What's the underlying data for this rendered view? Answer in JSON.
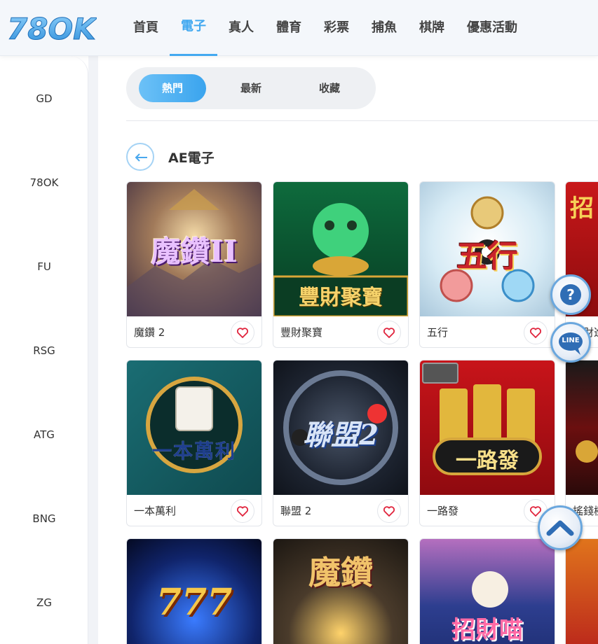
{
  "brand": {
    "logo_text": "78OK",
    "accent": "#43a9f0"
  },
  "nav": {
    "items": [
      {
        "label": "首頁"
      },
      {
        "label": "電子"
      },
      {
        "label": "真人"
      },
      {
        "label": "體育"
      },
      {
        "label": "彩票"
      },
      {
        "label": "捕魚"
      },
      {
        "label": "棋牌"
      },
      {
        "label": "優惠活動"
      }
    ],
    "active": "電子"
  },
  "sidebar": {
    "items": [
      {
        "label": "GD"
      },
      {
        "label": "78OK"
      },
      {
        "label": "FU"
      },
      {
        "label": "RSG"
      },
      {
        "label": "ATG"
      },
      {
        "label": "BNG"
      },
      {
        "label": "ZG"
      }
    ]
  },
  "filter_tabs": [
    {
      "label": "熱門",
      "active": true
    },
    {
      "label": "最新",
      "active": false
    },
    {
      "label": "收藏",
      "active": false
    }
  ],
  "section": {
    "title": "AE電子",
    "back_icon": "arrow-left-icon"
  },
  "games": [
    {
      "name": "魔鑽 2",
      "thumb_title": "魔鑽II"
    },
    {
      "name": "豐財聚寶",
      "thumb_title": "豐財聚寶"
    },
    {
      "name": "五行",
      "thumb_title": "五行"
    },
    {
      "name": "招財進寶",
      "thumb_title": "招"
    },
    {
      "name": "一本萬利",
      "thumb_title": "一本萬利"
    },
    {
      "name": "聯盟 2",
      "thumb_title": "聯盟2"
    },
    {
      "name": "一路發",
      "thumb_title": "一路發"
    },
    {
      "name": "搖錢樹",
      "thumb_title": ""
    },
    {
      "name": "",
      "thumb_title": "777"
    },
    {
      "name": "",
      "thumb_title": "魔鑽"
    },
    {
      "name": "",
      "thumb_title": "招財喵"
    },
    {
      "name": "",
      "thumb_title": ""
    }
  ],
  "floating": {
    "help_icon": "question-icon",
    "line_label": "LINE",
    "top_icon": "chevron-up-icon"
  }
}
